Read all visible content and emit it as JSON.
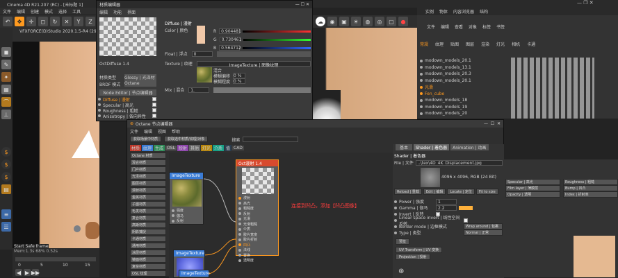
{
  "c4d": {
    "title": "Cinema 4D R21.207 (RC) - [未标题 1]",
    "scene_title": "VFXFORCE(D)Studio 2020.1.5-R4 (29 days le...",
    "menu": [
      "文件",
      "编辑",
      "创建",
      "模式",
      "选择",
      "工具",
      "网格",
      "捕捉"
    ],
    "viewport_label": "Start Safe frame",
    "status": "Mem:1.3s 68% 0.52s",
    "timeline": [
      "0",
      "5",
      "10",
      "15"
    ]
  },
  "mat_editor": {
    "title": "材质编辑器",
    "menu": [
      "编辑",
      "功能",
      "界面"
    ],
    "mat_name": "OctDiffuse 1.4",
    "material_type_label": "材质类型",
    "material_type": "Glossy | 光泽材质",
    "brdf_label": "BRDF 模式",
    "brdf": "Octane",
    "node_editor_btn": "Node Editor | 节点编辑器",
    "channels": [
      {
        "label": "Diffuse | 漫射",
        "on": true
      },
      {
        "label": "Specular | 高光",
        "on": true
      },
      {
        "label": "Roughness | 粗糙",
        "on": true
      },
      {
        "label": "Anisotropy | 各向异性",
        "on": false
      },
      {
        "label": "Sheen layer | 光泽层",
        "on": false
      },
      {
        "label": "Film layer | 薄膜",
        "on": false
      },
      {
        "label": "Bump | 凹凸",
        "on": false
      },
      {
        "label": "Normal | 法线",
        "on": false
      },
      {
        "label": "Opacity | 透明",
        "on": false
      },
      {
        "label": "Index | 折射率",
        "on": false
      },
      {
        "label": "Material layer",
        "on": false
      },
      {
        "label": "Round edges",
        "on": false
      },
      {
        "label": "Common | 常规",
        "on": false
      },
      {
        "label": "Editor | 编辑器",
        "on": false
      }
    ],
    "diffuse_heading": "Diffuse | 漫射",
    "color_label": "Color | 颜色",
    "rgb": [
      {
        "ch": "R",
        "val": "0.904481"
      },
      {
        "ch": "G",
        "val": "0.730461"
      },
      {
        "ch": "B",
        "val": "0.564712"
      }
    ],
    "swatch": "#f0c8a8",
    "float_label": "Float | 浮点",
    "float_val": "0",
    "texture_label": "Texture | 纹理",
    "texture_name": "ImageTexture | 图像纹理",
    "tex_props": [
      {
        "k": "混合",
        "v": ""
      },
      {
        "k": "模糊偏移",
        "v": "0 %"
      },
      {
        "k": "模糊程度",
        "v": "0 %"
      }
    ],
    "mix_label": "Mix | 混合",
    "mix_val": "1."
  },
  "scene_panel": {
    "tabs": [
      "实例",
      "物体",
      "内容浏览器",
      "结构"
    ],
    "menu": [
      "文件",
      "编辑",
      "查看",
      "对象",
      "标签",
      "书签"
    ],
    "toolbar": [
      "常规",
      "纹理",
      "贴图",
      "图层",
      "渲染",
      "灯光",
      "相机",
      "卡通"
    ],
    "objects": [
      "modown_models_20.1",
      "modown_models_13.1",
      "modown_models_20.3",
      "modown_models_20.1",
      "光滑",
      "Fen_cube",
      "modown_models_18",
      "modown_models_19",
      "modown_models_20"
    ]
  },
  "node_editor": {
    "title": "Octane 节点编辑器",
    "menu": [
      "文件",
      "编辑",
      "视图",
      "帮助"
    ],
    "buttons": [
      "获取场景中材质",
      "获取选中材质/纹理/对象"
    ],
    "search_label": "搜索",
    "categories": [
      "材质",
      "纹理",
      "生成",
      "OSL",
      "映射",
      "其他",
      "灯光",
      "介质",
      "值",
      "CAD"
    ],
    "left_list": [
      "Octane 材质",
      "混合材质",
      "门户材质",
      "光泽材质",
      "图层材质",
      "漫射材质",
      "金属材质",
      "子图材质",
      "毛发材质",
      "复合材质",
      "高斯材质",
      "阴影捕捉",
      "卡通材质",
      "通用材质",
      "涂层材质",
      "镜面材质",
      "复杂材质",
      "OSL 纹理",
      "OSL [camera]",
      "OSL [MAT]",
      "OSL [model]",
      "OSL [pattern]",
      "OSL [projection]",
      "OSL [texture]",
      "OSL [val]"
    ],
    "img_tex1": "ImageTexture",
    "img_tex1_pins": [
      "强度",
      "伽马",
      "反射"
    ],
    "img_tex2": "ImageTexture",
    "img_tex3": "ImageTexture",
    "main_node": "Oct漫射 1.4",
    "main_pins": [
      "漫射",
      "高光",
      "粗糙度",
      "反射",
      "光滑",
      "光滑粗糙",
      "介质",
      "胶片宽度",
      "胶片折射",
      "凹凸",
      "法线",
      "置换",
      "透明度"
    ],
    "annotation": "连接到凹凸，添加【凹凸图像】",
    "logo": "octane",
    "tabs": [
      "基本",
      "Shader | 着色器",
      "Animation | 动画"
    ],
    "shader_heading": "Shader | 着色器",
    "file_label": "File | 文件",
    "file_path": "..\\tex\\4D_4K_Displacement.jpg",
    "file_info": "4096 x 4096, RGB (24 Bit)",
    "file_btns": [
      "Reload | 重载",
      "Edit | 编辑",
      "Locate | 定位",
      "Fit to size"
    ],
    "params": [
      {
        "k": "Power | 强度",
        "v": "1"
      },
      {
        "k": "Gamma | 伽马",
        "v": "2.2"
      },
      {
        "k": "Invert | 反转",
        "v": ""
      },
      {
        "k": "Linear space invert | 线性空间反转",
        "v": ""
      },
      {
        "k": "Border mode | 边框模式",
        "v": "Wrap around | 包裹"
      },
      {
        "k": "Type | 类型",
        "v": "Normal | 正常"
      }
    ],
    "preview_btn": "预览",
    "uv_btn": "UV Transform | UV 变换",
    "proj_btn": "Projection | 投射"
  },
  "attr_right": {
    "rows": [
      [
        "Specular | 高光",
        "Roughness | 粗糙"
      ],
      [
        "Film layer | 薄膜层",
        "Bump | 凹凸"
      ],
      [
        "Opacity | 透明",
        "Index | 折射率"
      ]
    ]
  },
  "colors": {
    "accent_orange": "#ff9a1f",
    "red_node": "#d84a2e",
    "annotation": "#ff3d3d"
  }
}
